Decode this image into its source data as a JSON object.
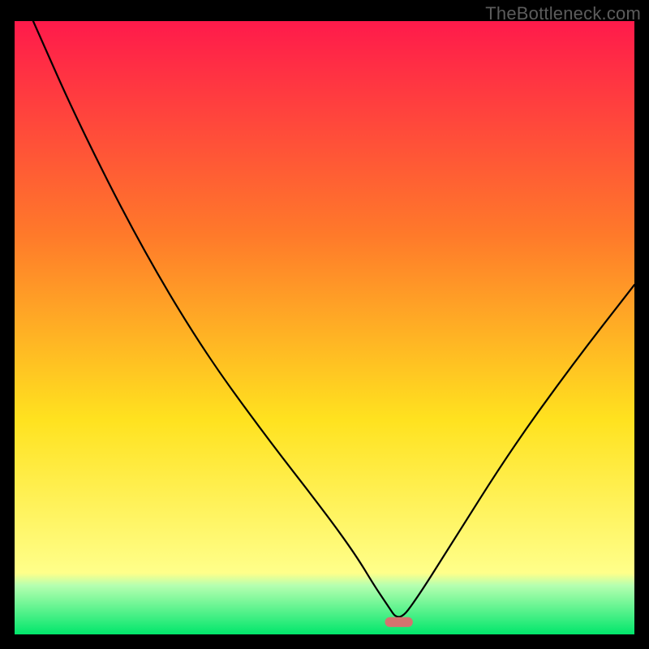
{
  "watermark": "TheBottleneck.com",
  "colors": {
    "gradient_top": "#ff1a4b",
    "gradient_mid1": "#ff7a2a",
    "gradient_mid2": "#ffe21f",
    "gradient_bottom_above_green": "#ffff8a",
    "gradient_green_top": "#b6ffb0",
    "gradient_green_bottom": "#00e66b",
    "curve": "#000000",
    "marker": "#d4736f",
    "frame": "#000000"
  },
  "chart_data": {
    "type": "line",
    "title": "",
    "xlabel": "",
    "ylabel": "",
    "xlim": [
      0,
      100
    ],
    "ylim": [
      0,
      100
    ],
    "grid": false,
    "legend": false,
    "curve_note": "V-shaped bottleneck curve; left arm is convex and starts at x≈3,y≈100 descending to the minimum; right arm is concave rising from the minimum to x≈100,y≈57. Minimum at x≈62,y≈2.",
    "series": [
      {
        "name": "bottleneck-curve",
        "x": [
          3,
          10,
          20,
          30,
          40,
          50,
          55,
          58,
          60,
          62,
          65,
          70,
          80,
          90,
          100
        ],
        "y": [
          100,
          84,
          64,
          47,
          33,
          20,
          13,
          8,
          5,
          2,
          6,
          14,
          30,
          44,
          57
        ]
      }
    ],
    "marker": {
      "x": 62,
      "y": 2,
      "width_pct": 4.5,
      "height_pct": 1.6
    },
    "green_band_top_pct": 92
  }
}
